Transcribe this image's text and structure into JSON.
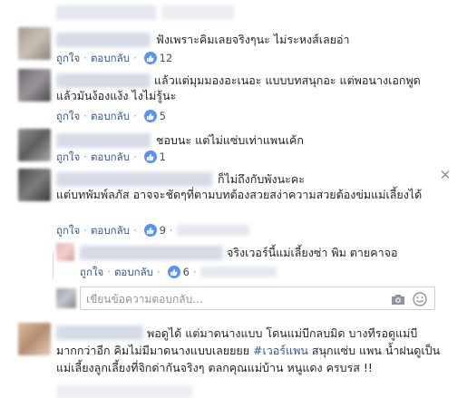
{
  "actions": {
    "like": "ถูกใจ",
    "reply": "ตอบกลับ",
    "separator": "·"
  },
  "comments": [
    {
      "text": "ฟังเพราะคิมเลยจริงๆนะ ไม่ระหงส์เลยอ่า",
      "likes": "12"
    },
    {
      "text": "แล้วแต่มุมมองอะเนอะ แบบบทสนุกอะ แต่พอนางเอกพูดแล้วมันง้องแง้ง ไงไม่รู้นะ",
      "likes": "5"
    },
    {
      "text": "ชอบนะ แต่ไม่แซ่บเท่าแพนเค้ก",
      "likes": "1"
    },
    {
      "text_line1": "ก็ไม่ถึงกับพังนะคะ",
      "text_rest": "แต่บทพัมพ์ลภัส อาจจะชัดๆที่ตามบทต้องสวยสง่าความสวยต้องข่มแม่เลี้ยงได้",
      "likes": "9"
    },
    {
      "text": "จริงเวอร์นี้แม่เลี้ยงซ่า พิม ตายคาจอ",
      "likes": "6"
    },
    {
      "text_before": "พอดูได้ แต่มาดนางแบบ โดนแม่บีกลบมิด บางทีรอดูแม่บีมากกว่าอีก คิมไม่มีมาดนางแบบเลยยยย ",
      "hashtag": "#เวอร์แพน",
      "text_after": " สนุกแซ่บ แพน น้ำฝนดูเป็น แม่เลี้ยงลูกเลี้ยงที่จิกด่ากันจริงๆ ตลกคุณแม่บ้าน หนูแดง ครบรส !!"
    }
  ],
  "reply_box": {
    "placeholder": "เขียนข้อความตอบกลับ..."
  },
  "icons": {
    "like": "thumbs-up-icon",
    "camera": "camera-icon",
    "emoji": "smiley-icon",
    "close": "close-icon"
  },
  "colors": {
    "link": "#365899",
    "like_badge": "#5890ff",
    "text": "#1d2129",
    "muted": "#90949c"
  }
}
